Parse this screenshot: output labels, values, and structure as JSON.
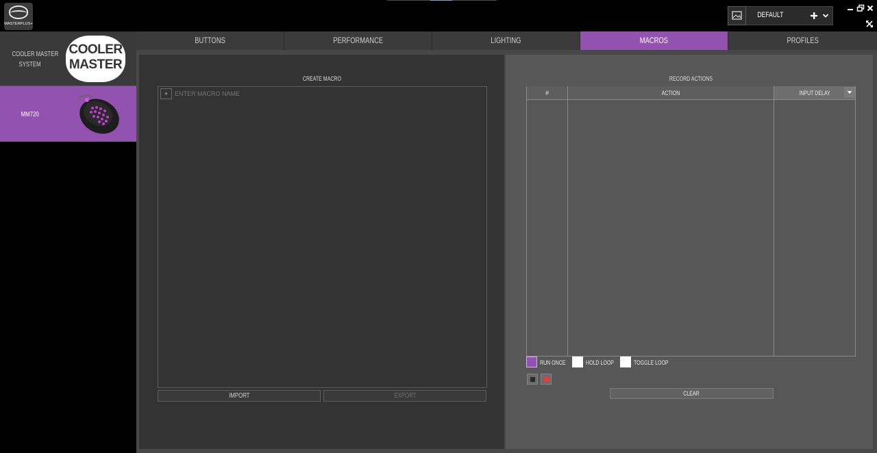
{
  "app": {
    "logo_text": "MASTERPLUS+",
    "profile_name": "DEFAULT",
    "window_controls": [
      "minimize-icon",
      "restore-icon",
      "close-icon",
      "collapse-icon"
    ]
  },
  "sidebar": {
    "system_label_line1": "COOLER MASTER",
    "system_label_line2": "SYSTEM",
    "brand_logo_line1": "COOLER",
    "brand_logo_line2": "MASTER",
    "device_label": "MM720"
  },
  "tabs": [
    {
      "label": "BUTTONS"
    },
    {
      "label": "PERFORMANCE"
    },
    {
      "label": "LIGHTING"
    },
    {
      "label": "MACROS",
      "active": true
    },
    {
      "label": "PROFILES"
    }
  ],
  "create_macro": {
    "title": "CREATE MACRO",
    "add_symbol": "+",
    "name_placeholder": "ENTER MACRO NAME",
    "import_label": "IMPORT",
    "export_label": "EXPORT"
  },
  "record_actions": {
    "title": "RECORD ACTIONS",
    "columns": [
      "#",
      "ACTION",
      "INPUT DELAY"
    ],
    "modes": [
      {
        "label": "RUN ONCE",
        "selected": true
      },
      {
        "label": "HOLD LOOP",
        "selected": false
      },
      {
        "label": "TOGGLE LOOP",
        "selected": false
      }
    ],
    "clear_label": "CLEAR"
  },
  "colors": {
    "accent": "#9452b0",
    "background": "#000000",
    "panel_dark": "#333333",
    "panel_light": "#575757"
  }
}
